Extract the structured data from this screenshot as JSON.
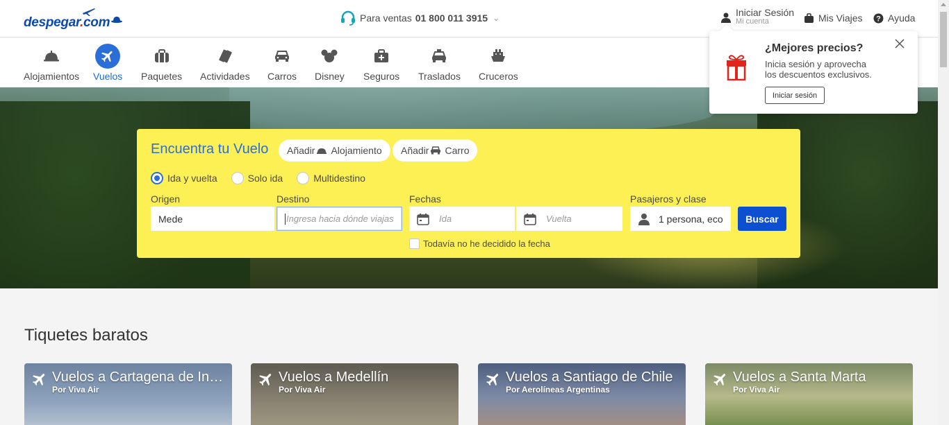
{
  "header": {
    "logo": {
      "text_main": "despegar",
      "text_dot": ".",
      "text_com": "com"
    },
    "phone": {
      "label": "Para ventas",
      "number": "01 800 011 3915",
      "icon": "headset-icon"
    },
    "login": {
      "label": "Iniciar Sesión",
      "sub": "Mi cuenta",
      "icon": "user-icon"
    },
    "trips": {
      "label": "Mis Viajes",
      "icon": "suitcase-icon"
    },
    "help": {
      "label": "Ayuda",
      "icon": "help-icon"
    }
  },
  "nav": {
    "items": [
      {
        "label": "Alojamientos",
        "icon": "cloche-icon"
      },
      {
        "label": "Vuelos",
        "icon": "plane-icon",
        "active": true
      },
      {
        "label": "Paquetes",
        "icon": "suitcase-icon"
      },
      {
        "label": "Actividades",
        "icon": "tickets-icon"
      },
      {
        "label": "Carros",
        "icon": "car-icon"
      },
      {
        "label": "Disney",
        "icon": "mouse-ears-icon"
      },
      {
        "label": "Seguros",
        "icon": "medical-bag-icon"
      },
      {
        "label": "Traslados",
        "icon": "taxi-icon"
      },
      {
        "label": "Cruceros",
        "icon": "ship-icon"
      }
    ]
  },
  "search": {
    "title": "Encuentra tu Vuelo",
    "add_hotel": "Añadir",
    "add_hotel_2": "Alojamiento",
    "add_car": "Añadir",
    "add_car_2": "Carro",
    "trip_types": [
      "Ida y vuelta",
      "Solo ida",
      "Multidestino"
    ],
    "selected_trip_type": "Ida y vuelta",
    "origin": {
      "label": "Origen",
      "value": "Mede"
    },
    "destination": {
      "label": "Destino",
      "placeholder": "Ingresa hacia dónde viajas"
    },
    "dates": {
      "label": "Fechas",
      "depart_placeholder": "Ida",
      "return_placeholder": "Vuelta"
    },
    "passengers": {
      "label": "Pasajeros y clase",
      "value": "1 persona, eco"
    },
    "search_button": "Buscar",
    "undecided_date": "Todavía no he decidido la fecha"
  },
  "popover": {
    "title": "¿Mejores precios?",
    "text_1": "Inicia sesión y aprovecha",
    "text_2": "los descuentos exclusivos.",
    "button": "Iniciar sesión"
  },
  "deals": {
    "title": "Tiquetes baratos",
    "cards": [
      {
        "title": "Vuelos a Cartagena de Indias",
        "sub": "Por Viva Air",
        "color": "#6f86a3"
      },
      {
        "title": "Vuelos a Medellín",
        "sub": "Por Viva Air",
        "color": "#7d7a6e"
      },
      {
        "title": "Vuelos a Santiago de Chile",
        "sub": "Por Aerolíneas Argentinas",
        "color": "#5b6a88"
      },
      {
        "title": "Vuelos a Santa Marta",
        "sub": "Por Viva Air",
        "color": "#8d9a6a"
      }
    ]
  },
  "colors": {
    "brand_blue": "#0d4aa8",
    "active_blue": "#2a6ed8",
    "search_yellow": "#fdf055",
    "button_blue": "#0c4fd0",
    "gift_red": "#e0261c"
  }
}
